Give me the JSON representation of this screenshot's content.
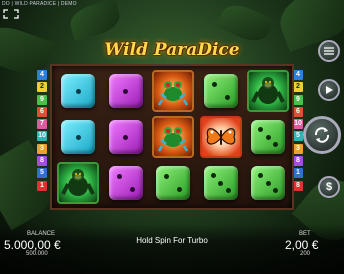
{
  "header": {
    "caption": "DO | WILD PARADICE | DEMO"
  },
  "game": {
    "logo_text": "Wild ParaDice"
  },
  "paylines": {
    "left": [
      "4",
      "2",
      "9",
      "6",
      "7",
      "10",
      "3",
      "8",
      "5",
      "1"
    ],
    "right": [
      "4",
      "2",
      "9",
      "6",
      "10",
      "5",
      "3",
      "8",
      "1",
      "8"
    ],
    "colors": [
      "#2f7fe0",
      "#f0d030",
      "#49c04a",
      "#e05030",
      "#e05aa0",
      "#2fb5b5",
      "#f0a030",
      "#a050e0",
      "#3070d0",
      "#e03030"
    ]
  },
  "reels": [
    [
      "die-cyan-1",
      "die-cyan-1",
      "gorilla"
    ],
    [
      "die-magenta-1",
      "die-magenta-1",
      "die-magenta-2"
    ],
    [
      "frog",
      "frog",
      "die-green-2"
    ],
    [
      "die-green-2",
      "butterfly",
      "die-green-3"
    ],
    [
      "gorilla",
      "die-green-3",
      "die-green-3"
    ]
  ],
  "controls": {
    "menu_icon": "menu-icon",
    "play_icon": "play-icon",
    "spin_icon": "spin-icon",
    "bet_icon": "dollar-icon"
  },
  "footer": {
    "balance_label": "BALANCE",
    "balance_value": "5.000,00 €",
    "balance_sub": "500.000",
    "hint": "Hold Spin For Turbo",
    "bet_label": "BET",
    "bet_value": "2,00 €",
    "bet_sub": "200"
  }
}
